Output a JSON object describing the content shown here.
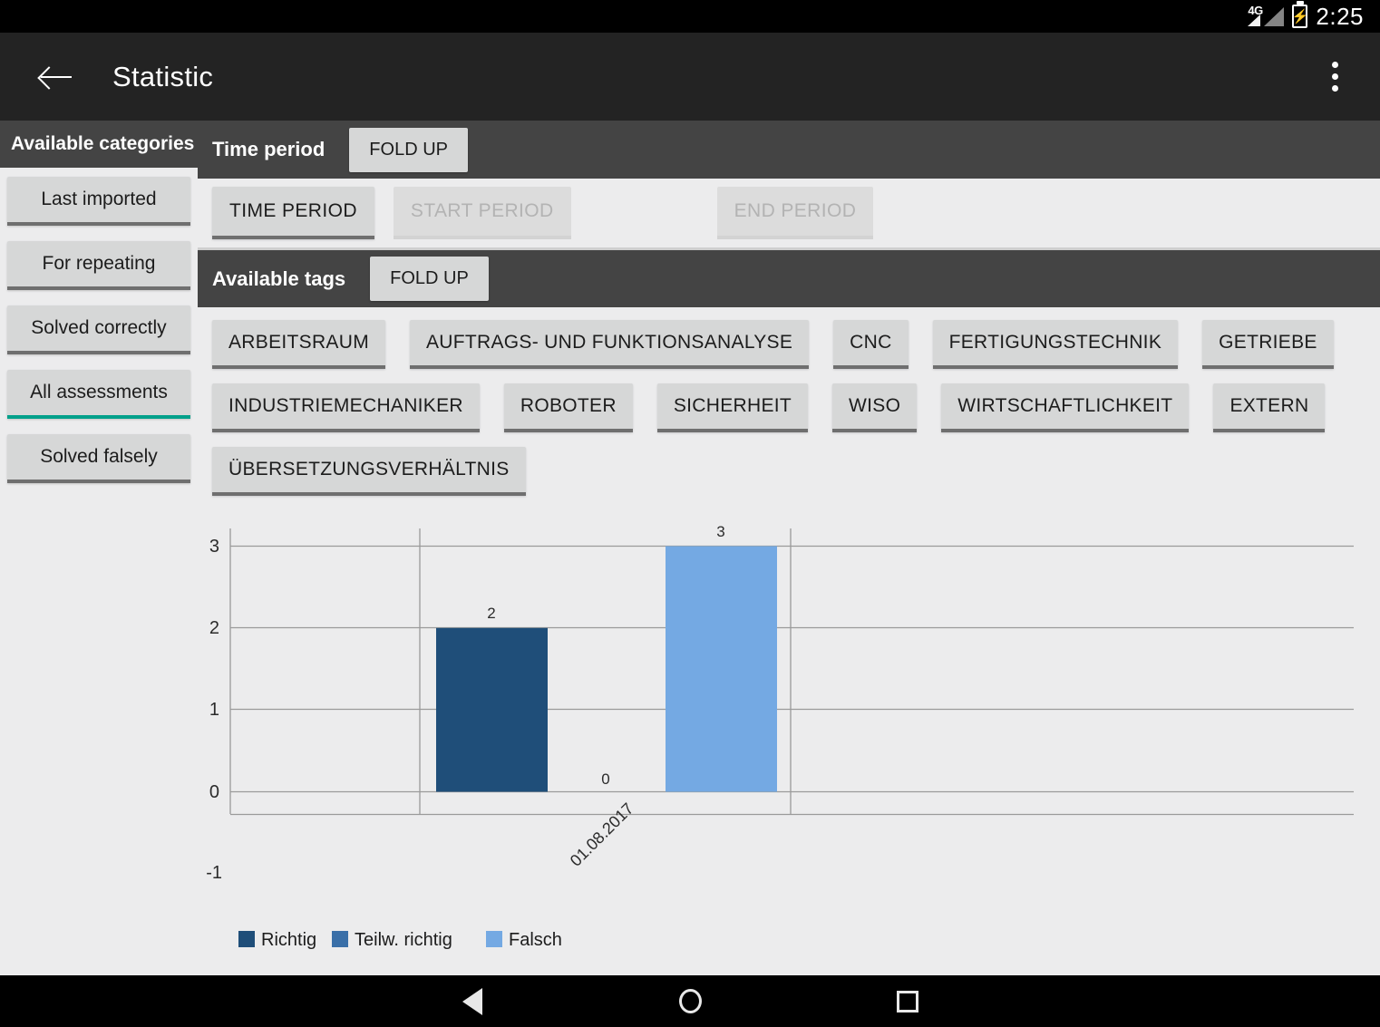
{
  "statusbar": {
    "network": "4G",
    "network_icon": "signal-icon",
    "battery_icon": "battery-charging-icon",
    "time": "2:25"
  },
  "appbar": {
    "back_icon": "back-arrow-icon",
    "title": "Statistic",
    "overflow_icon": "overflow-menu-icon"
  },
  "sidebar": {
    "header": "Available categories",
    "items": [
      {
        "label": "Last imported",
        "selected": false
      },
      {
        "label": "For repeating",
        "selected": false
      },
      {
        "label": "Solved correctly",
        "selected": false
      },
      {
        "label": "All assessments",
        "selected": true
      },
      {
        "label": "Solved falsely",
        "selected": false
      }
    ],
    "selected_accent": "#00a08a"
  },
  "time_period": {
    "title": "Time period",
    "fold_label": "FOLD UP",
    "buttons": [
      {
        "label": "TIME PERIOD",
        "disabled": false
      },
      {
        "label": "START PERIOD",
        "disabled": true
      },
      {
        "label": "END PERIOD",
        "disabled": true
      }
    ]
  },
  "tags": {
    "title": "Available tags",
    "fold_label": "FOLD UP",
    "rows": [
      [
        "ARBEITSRAUM",
        "AUFTRAGS- UND FUNKTIONSANALYSE",
        "CNC",
        "FERTIGUNGSTECHNIK",
        "GETRIEBE"
      ],
      [
        "INDUSTRIEMECHANIKER",
        "ROBOTER",
        "SICHERHEIT",
        "WISO",
        "WIRTSCHAFTLICHKEIT",
        "EXTERN"
      ],
      [
        "ÜBERSETZUNGSVERHÄLTNIS"
      ]
    ]
  },
  "chart_data": {
    "type": "bar",
    "title": "",
    "xlabel": "",
    "ylabel": "",
    "categories": [
      "01.08.2017"
    ],
    "series": [
      {
        "name": "Richtig",
        "color": "#1f4e79",
        "values": [
          2
        ]
      },
      {
        "name": "Teilw. richtig",
        "color": "#3a6fa8",
        "values": [
          0
        ]
      },
      {
        "name": "Falsch",
        "color": "#74a9e3",
        "values": [
          3
        ]
      }
    ],
    "data_labels": [
      "2",
      "0",
      "3"
    ],
    "ytick_labels": [
      "3",
      "2",
      "1",
      "0",
      "-1"
    ],
    "ytick_values": [
      3,
      2,
      1,
      0,
      -1
    ],
    "ylim": [
      -1,
      3.4
    ],
    "grid": true,
    "legend_position": "bottom-left",
    "plot_background": "#ececed",
    "grid_color": "#9a9a9a"
  },
  "navbar": {
    "back_icon": "nav-back-icon",
    "home_icon": "nav-home-icon",
    "recents_icon": "nav-recents-icon"
  }
}
